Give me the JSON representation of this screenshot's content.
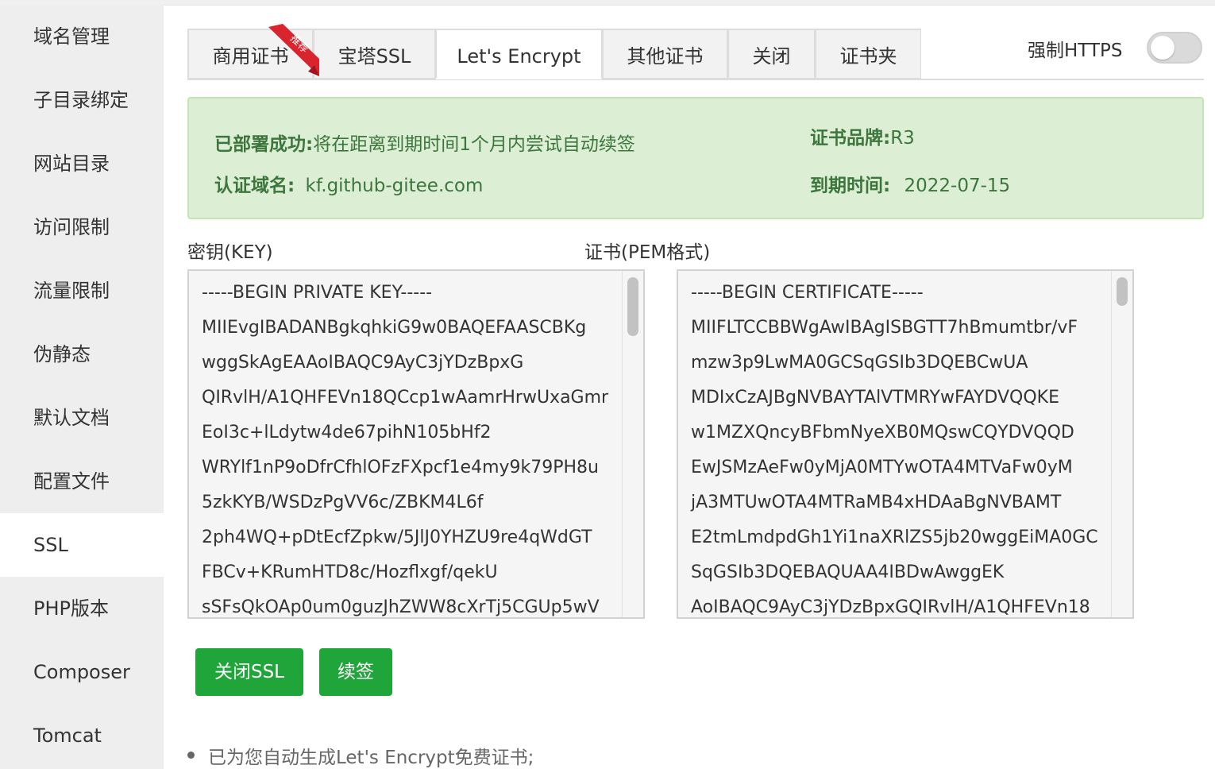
{
  "sidebar": {
    "items": [
      {
        "label": "域名管理"
      },
      {
        "label": "子目录绑定"
      },
      {
        "label": "网站目录"
      },
      {
        "label": "访问限制"
      },
      {
        "label": "流量限制"
      },
      {
        "label": "伪静态"
      },
      {
        "label": "默认文档"
      },
      {
        "label": "配置文件"
      },
      {
        "label": "SSL",
        "active": true
      },
      {
        "label": "PHP版本"
      },
      {
        "label": "Composer"
      },
      {
        "label": "Tomcat"
      }
    ]
  },
  "tabs": [
    {
      "label": "商用证书",
      "ribbon": "推荐"
    },
    {
      "label": "宝塔SSL"
    },
    {
      "label": "Let's Encrypt",
      "active": true
    },
    {
      "label": "其他证书"
    },
    {
      "label": "关闭"
    },
    {
      "label": "证书夹"
    }
  ],
  "force_https": {
    "label": "强制HTTPS",
    "enabled": false
  },
  "status": {
    "deploy_label": "已部署成功:",
    "deploy_text": "将在距离到期时间1个月内尝试自动续签",
    "domain_label": "认证域名:",
    "domain_value": "kf.github-gitee.com",
    "brand_label": "证书品牌:",
    "brand_value": "R3",
    "expire_label": "到期时间:",
    "expire_value": "2022-07-15"
  },
  "key_field": {
    "label": "密钥(KEY)",
    "lines": [
      "-----BEGIN PRIVATE KEY-----",
      "MIIEvgIBADANBgkqhkiG9w0BAQEFAASCBKg",
      "wggSkAgEAAoIBAQC9AyC3jYDzBpxG",
      "QIRvlH/A1QHFEVn18QCcp1wAamrHrwUxaGmr",
      "EoI3c+lLdytw4de67pihN105bHf2",
      "WRYlf1nP9oDfrCfhlOFzFXpcf1e4my9k79PH8u",
      "5zkKYB/WSDzPgVV6c/ZBKM4L6f",
      "2ph4WQ+pDtEcfZpkw/5JlJ0YHZU9re4qWdGT",
      "FBCv+KRumHTD8c/Hozflxgf/qekU",
      "sSFsQkOAp0um0guzJhZWW8cXrTj5CGUp5wV"
    ]
  },
  "cert_field": {
    "label": "证书(PEM格式)",
    "lines": [
      "-----BEGIN CERTIFICATE-----",
      "MIIFLTCCBBWgAwIBAgISBGTT7hBmumtbr/vF",
      "mzw3p9LwMA0GCSqGSIb3DQEBCwUA",
      "MDIxCzAJBgNVBAYTAlVTMRYwFAYDVQQKE",
      "w1MZXQncyBFbmNyeXB0MQswCQYDVQQD",
      "EwJSMzAeFw0yMjA0MTYwOTA4MTVaFw0yM",
      "jA3MTUwOTA4MTRaMB4xHDAaBgNVBAMT",
      "E2tmLmdpdGh1Yi1naXRlZS5jb20wggEiMA0GC",
      "SqGSIb3DQEBAQUAA4IBDwAwggEK",
      "AoIBAQC9AyC3jYDzBpxGQIRvlH/A1QHFEVn18"
    ]
  },
  "buttons": {
    "close_ssl": "关闭SSL",
    "renew": "续签"
  },
  "notes": [
    "已为您自动生成Let's Encrypt免费证书;"
  ],
  "colors": {
    "primary": "#20a53a",
    "success_bg": "#dcefd5",
    "success_text": "#3c763d"
  }
}
